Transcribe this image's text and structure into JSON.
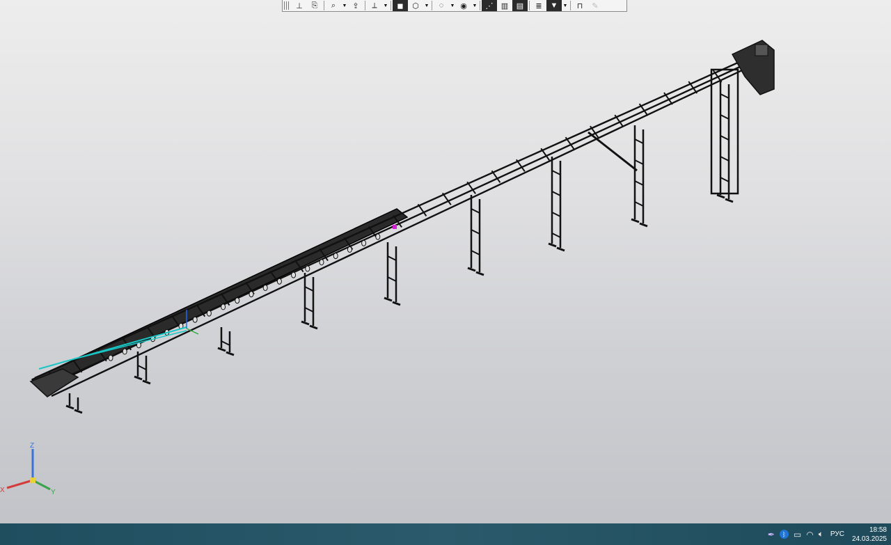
{
  "toolbar": {
    "buttons": [
      {
        "icon": "sketch-icon",
        "glyph": "⊥",
        "active": false
      },
      {
        "icon": "document-icon",
        "glyph": "⎘",
        "active": false
      },
      {
        "icon": "zoom-icon",
        "glyph": "⌕",
        "active": false,
        "dropdown": true
      },
      {
        "icon": "pan-icon",
        "glyph": "⇪",
        "active": false
      },
      {
        "icon": "orient-icon",
        "glyph": "⟂",
        "active": false,
        "dropdown": true
      },
      {
        "icon": "shaded-cube-icon",
        "glyph": "◼",
        "active": true
      },
      {
        "icon": "wireframe-cube-icon",
        "glyph": "⬡",
        "active": false,
        "dropdown": true
      },
      {
        "icon": "hide-icon",
        "glyph": "◌",
        "active": false,
        "dropdown": true
      },
      {
        "icon": "display-mode-icon",
        "glyph": "◉",
        "active": false,
        "dropdown": true
      },
      {
        "icon": "constraints-icon",
        "glyph": "⋰",
        "active": true
      },
      {
        "icon": "layers-icon",
        "glyph": "▥",
        "active": false
      },
      {
        "icon": "sheet-icon",
        "glyph": "▤",
        "active": true
      },
      {
        "icon": "stack-icon",
        "glyph": "≣",
        "active": false
      },
      {
        "icon": "filter-icon",
        "glyph": "▼",
        "active": true,
        "dropdown": true
      },
      {
        "icon": "measure-icon",
        "glyph": "⊓",
        "active": false
      },
      {
        "icon": "pencil-icon",
        "glyph": "✎",
        "active": false,
        "disabled": true
      }
    ]
  },
  "axes": {
    "x_label": "X",
    "y_label": "Y",
    "z_label": "Z"
  },
  "taskbar": {
    "language": "РУС",
    "time": "18:58",
    "date": "24.03.2025",
    "tray_icons": [
      "pen-icon",
      "bluetooth-icon",
      "battery-icon",
      "wifi-icon",
      "volume-icon"
    ]
  }
}
